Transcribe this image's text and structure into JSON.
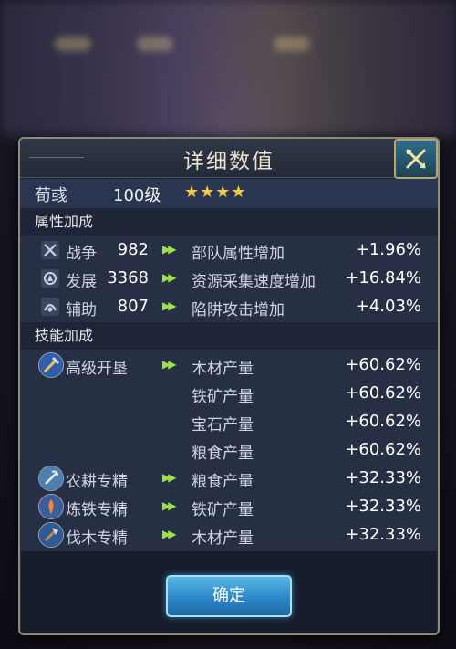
{
  "dialog": {
    "title": "详细数值",
    "hero": {
      "name": "荀彧",
      "level": "100级",
      "stars": "★★★★",
      "star_count": 4
    },
    "attribute_section": {
      "header": "属性加成",
      "rows": [
        {
          "icon": "crossed-swords-icon",
          "name": "战争",
          "value": "982",
          "effect": "部队属性增加",
          "bonus": "+1.96%"
        },
        {
          "icon": "development-icon",
          "name": "发展",
          "value": "3368",
          "effect": "资源采集速度增加",
          "bonus": "+16.84%"
        },
        {
          "icon": "support-icon",
          "name": "辅助",
          "value": "807",
          "effect": "陷阱攻击增加",
          "bonus": "+4.03%"
        }
      ]
    },
    "skill_section": {
      "header": "技能加成",
      "rows": [
        {
          "icon": "advanced-reclaim-icon",
          "name": "高级开垦",
          "effect": "木材产量",
          "bonus": "+60.62%"
        },
        {
          "icon": "",
          "name": "",
          "effect": "铁矿产量",
          "bonus": "+60.62%"
        },
        {
          "icon": "",
          "name": "",
          "effect": "宝石产量",
          "bonus": "+60.62%"
        },
        {
          "icon": "",
          "name": "",
          "effect": "粮食产量",
          "bonus": "+60.62%"
        },
        {
          "icon": "farming-mastery-icon",
          "name": "农耕专精",
          "effect": "粮食产量",
          "bonus": "+32.33%"
        },
        {
          "icon": "smelting-mastery-icon",
          "name": "炼铁专精",
          "effect": "铁矿产量",
          "bonus": "+32.33%"
        },
        {
          "icon": "logging-mastery-icon",
          "name": "伐木专精",
          "effect": "木材产量",
          "bonus": "+32.33%"
        }
      ]
    },
    "confirm_label": "确定",
    "colors": {
      "accent_blue": "#2c86c7",
      "arrow_green": "#9fe04a",
      "star_gold": "#f4c94b"
    }
  }
}
